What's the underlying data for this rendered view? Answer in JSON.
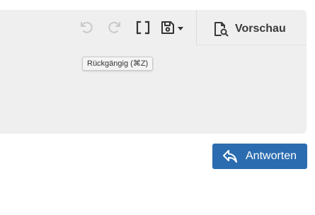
{
  "toolbar": {
    "undo_icon": "undo-icon",
    "redo_icon": "redo-icon",
    "fullscreen_icon": "brackets-icon",
    "save_icon": "floppy-disk-icon",
    "save_dropdown_icon": "caret-down-icon",
    "preview_label": "Vorschau",
    "preview_icon": "document-search-icon"
  },
  "tooltip": {
    "text": "Rückgängig (⌘Z)"
  },
  "actions": {
    "reply_label": "Antworten",
    "reply_icon": "reply-arrow-icon"
  },
  "colors": {
    "panel_background": "#efefef",
    "icon_active": "#333333",
    "icon_disabled": "#c8c8c8",
    "reply_button": "#2b6cb0"
  }
}
